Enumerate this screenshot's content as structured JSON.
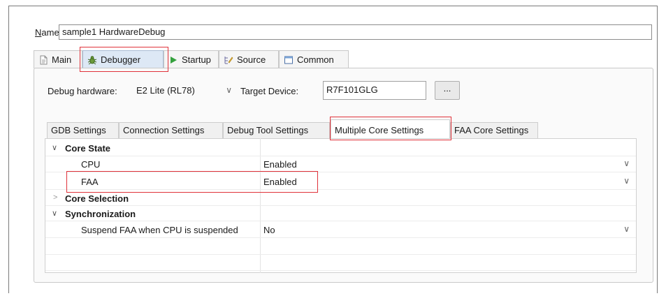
{
  "config": {
    "name_label_prefix": "N",
    "name_label_rest": "ame:",
    "name_value": "sample1 HardwareDebug"
  },
  "main_tabs": [
    {
      "label": "Main",
      "icon": "document-icon"
    },
    {
      "label": "Debugger",
      "icon": "bug-icon",
      "active": true
    },
    {
      "label": "Startup",
      "icon": "play-icon"
    },
    {
      "label": "Source",
      "icon": "source-icon"
    },
    {
      "label": "Common",
      "icon": "window-icon"
    }
  ],
  "debugger": {
    "hardware_label": "Debug hardware:",
    "hardware_value": "E2 Lite (RL78)",
    "target_label": "Target Device:",
    "target_value": "R7F101GLG",
    "browse_label": "..."
  },
  "sub_tabs": [
    {
      "label": "GDB Settings"
    },
    {
      "label": "Connection Settings"
    },
    {
      "label": "Debug Tool Settings"
    },
    {
      "label": "Multiple Core Settings",
      "active": true
    },
    {
      "label": "FAA Core Settings"
    }
  ],
  "table": {
    "rows": [
      {
        "type": "group",
        "label": "Core State",
        "expanded": true
      },
      {
        "type": "item",
        "label": "CPU",
        "value": "Enabled"
      },
      {
        "type": "item",
        "label": "FAA",
        "value": "Enabled"
      },
      {
        "type": "group",
        "label": "Core Selection",
        "expanded": false
      },
      {
        "type": "group",
        "label": "Synchronization",
        "expanded": true
      },
      {
        "type": "item",
        "label": "Suspend FAA when CPU is suspended",
        "value": "No"
      }
    ]
  },
  "colors": {
    "highlight": "#e0323a",
    "active_tab": "#dde8f5"
  }
}
